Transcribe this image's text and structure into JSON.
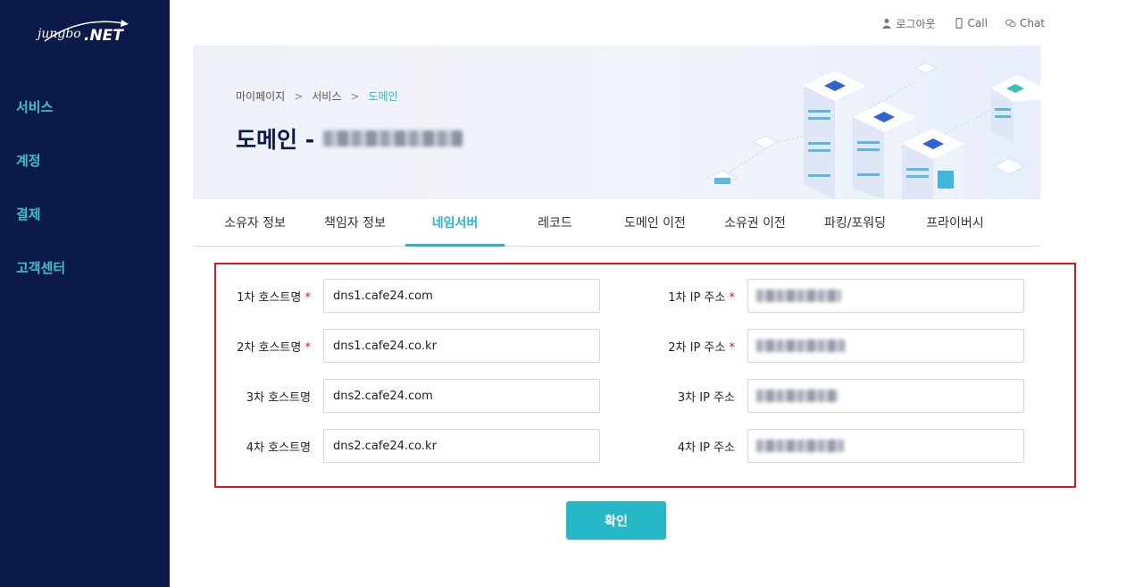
{
  "brand": {
    "logo_text": "jungbo.NET"
  },
  "sidebar": {
    "items": [
      {
        "label": "서비스"
      },
      {
        "label": "계정"
      },
      {
        "label": "결제"
      },
      {
        "label": "고객센터"
      }
    ]
  },
  "topbar": {
    "logout": "로그아웃",
    "call": "Call",
    "chat": "Chat"
  },
  "breadcrumb": [
    "마이페이지",
    "서비스",
    "도메인"
  ],
  "page": {
    "title_prefix": "도메인 -"
  },
  "tabs": [
    {
      "label": "소유자 정보",
      "active": false
    },
    {
      "label": "책임자 정보",
      "active": false
    },
    {
      "label": "네임서버",
      "active": true
    },
    {
      "label": "레코드",
      "active": false
    },
    {
      "label": "도메인 이전",
      "active": false
    },
    {
      "label": "소유권 이전",
      "active": false
    },
    {
      "label": "파킹/포워딩",
      "active": false
    },
    {
      "label": "프라이버시",
      "active": false
    }
  ],
  "form": {
    "hosts": [
      {
        "label": "1차 호스트명",
        "required": "*",
        "value": "dns1.cafe24.com"
      },
      {
        "label": "2차 호스트명",
        "required": "*",
        "value": "dns1.cafe24.co.kr"
      },
      {
        "label": "3차 호스트명",
        "required": "",
        "value": "dns2.cafe24.com"
      },
      {
        "label": "4차 호스트명",
        "required": "",
        "value": "dns2.cafe24.co.kr"
      }
    ],
    "ips": [
      {
        "label": "1차 IP 주소",
        "required": "*"
      },
      {
        "label": "2차 IP 주소",
        "required": "*"
      },
      {
        "label": "3차 IP 주소",
        "required": ""
      },
      {
        "label": "4차 IP 주소",
        "required": ""
      }
    ]
  },
  "confirm_label": "확인",
  "colors": {
    "sidebar": "#0b1a49",
    "accent": "#26b7c7",
    "required": "#e0141e"
  }
}
